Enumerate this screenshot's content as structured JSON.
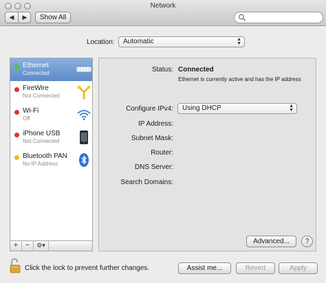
{
  "window": {
    "title": "Network"
  },
  "toolbar": {
    "back_glyph": "◀",
    "forward_glyph": "▶",
    "show_all_label": "Show All"
  },
  "location": {
    "label": "Location:",
    "value": "Automatic"
  },
  "services": [
    {
      "name": "Ethernet",
      "status": "Connected",
      "dot_color": "#4fc339",
      "icon": "ethernet-icon",
      "selected": true
    },
    {
      "name": "FireWire",
      "status": "Not Connected",
      "dot_color": "#e0322c",
      "icon": "firewire-icon",
      "selected": false
    },
    {
      "name": "Wi-Fi",
      "status": "Off",
      "dot_color": "#e0322c",
      "icon": "wifi-icon",
      "selected": false
    },
    {
      "name": "iPhone USB",
      "status": "Not Connected",
      "dot_color": "#e0322c",
      "icon": "iphone-icon",
      "selected": false
    },
    {
      "name": "Bluetooth PAN",
      "status": "No IP Address",
      "dot_color": "#f0b428",
      "icon": "bluetooth-icon",
      "selected": false
    }
  ],
  "service_tools": {
    "add": "+",
    "remove": "−",
    "gear": "⚙▾"
  },
  "detail": {
    "status_label": "Status:",
    "status_value": "Connected",
    "status_description": "Ethernet is currently active and has the IP address",
    "configure_label": "Configure IPv4:",
    "configure_value": "Using DHCP",
    "fields": [
      {
        "label": "IP Address:"
      },
      {
        "label": "Subnet Mask:"
      },
      {
        "label": "Router:"
      },
      {
        "label": "DNS Server:"
      },
      {
        "label": "Search Domains:"
      }
    ],
    "advanced_label": "Advanced...",
    "help_label": "?"
  },
  "footer": {
    "lock_text": "Click the lock to prevent further changes.",
    "assist_label": "Assist me...",
    "revert_label": "Revert",
    "apply_label": "Apply"
  },
  "colors": {
    "selection_gradient_top": "#8ab1de",
    "selection_gradient_bottom": "#5c8bc9",
    "status_green": "#4fc339",
    "status_red": "#e0322c",
    "status_amber": "#f0b428"
  }
}
